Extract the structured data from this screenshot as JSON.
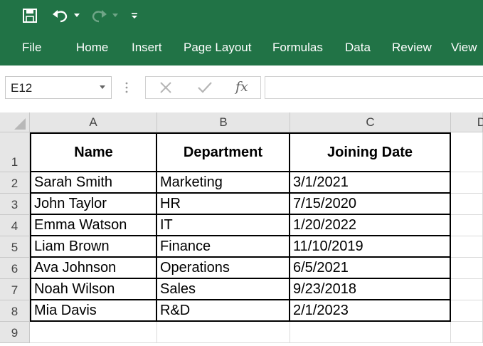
{
  "qat": {
    "save_icon": "save-icon",
    "undo_icon": "undo-icon",
    "redo_icon": "redo-icon",
    "customize_icon": "customize-qat-icon"
  },
  "ribbon": {
    "tabs": [
      "File",
      "Home",
      "Insert",
      "Page Layout",
      "Formulas",
      "Data",
      "Review",
      "View"
    ]
  },
  "formula_bar": {
    "name_box": "E12",
    "fx_label": "fx",
    "formula_value": ""
  },
  "sheet": {
    "columns": [
      "A",
      "B",
      "C",
      "D"
    ],
    "rows": [
      "1",
      "2",
      "3",
      "4",
      "5",
      "6",
      "7",
      "8",
      "9"
    ],
    "table": {
      "headers": [
        "Name",
        "Department",
        "Joining Date"
      ],
      "rows": [
        [
          "Sarah Smith",
          "Marketing",
          "3/1/2021"
        ],
        [
          "John Taylor",
          "HR",
          "7/15/2020"
        ],
        [
          "Emma Watson",
          "IT",
          "1/20/2022"
        ],
        [
          "Liam Brown",
          "Finance",
          "11/10/2019"
        ],
        [
          "Ava Johnson",
          "Operations",
          "6/5/2021"
        ],
        [
          "Noah Wilson",
          "Sales",
          "9/23/2018"
        ],
        [
          "Mia Davis",
          "R&D",
          "2/1/2023"
        ]
      ]
    }
  },
  "colors": {
    "ribbon_green": "#217346",
    "header_gray": "#e6e6e6"
  }
}
